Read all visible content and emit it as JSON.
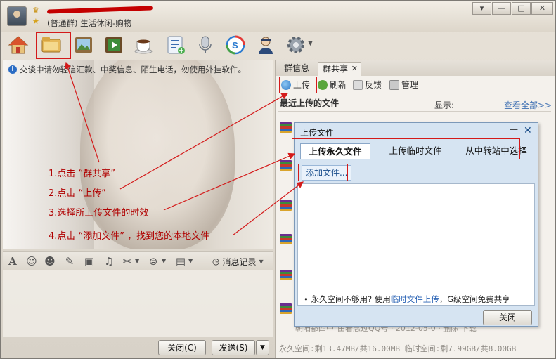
{
  "header": {
    "group_name_hidden": "",
    "group_type": "(普通群) 生活休闲-购物",
    "window_buttons": {
      "menu": "▾",
      "minimize": "—",
      "maximize": "□",
      "close": "✕"
    }
  },
  "toolbar": {
    "icons": [
      "home-icon",
      "group-share-icon",
      "photo-icon",
      "video-icon",
      "coffee-icon",
      "notes-icon",
      "mic-icon",
      "sync-icon",
      "person-icon",
      "gear-icon"
    ]
  },
  "chat": {
    "notice": "交谈中请勿轻信汇款、中奖信息、陌生电话，勿使用外挂软件。",
    "steps": [
      "1.点击 “群共享”",
      "2.点击 “上传”",
      "3.选择所上传文件的时效",
      "4.点击 “添加文件” ，找到您的本地文件"
    ]
  },
  "input_toolbar": {
    "history": "消息记录"
  },
  "bottom": {
    "close": "关闭(C)",
    "send": "发送(S)"
  },
  "right": {
    "tabs": [
      "群信息",
      "群共享"
    ],
    "tab_close": "✕",
    "tools": {
      "upload": "上传",
      "refresh": "刷新",
      "feedback": "反馈",
      "manage": "管理"
    },
    "recent_title": "最近上传的文件",
    "display_label": "显示:",
    "view_all": "查看全部>>",
    "faded_row": "朝阳都四中\"由着念过QQ号 · 2012-05-0 ·         删除     下载",
    "space_info": "永久空间:剩13.47MB/共16.00MB 临时空间:剩7.99GB/共8.00GB"
  },
  "dialog": {
    "title": "上传文件",
    "min": "—",
    "close": "✕",
    "tabs": [
      "上传永久文件",
      "上传临时文件",
      "从中转站中选择"
    ],
    "add_file": "添加文件...",
    "tip_prefix": "• 永久空间不够用? 使用",
    "tip_link": "临时文件上传",
    "tip_suffix": "，G级空间免费共享",
    "close_button": "关闭"
  },
  "colors": {
    "annotation": "#d41a1a",
    "link": "#2a63b5",
    "dialog_bg": "#d6e4f2"
  }
}
